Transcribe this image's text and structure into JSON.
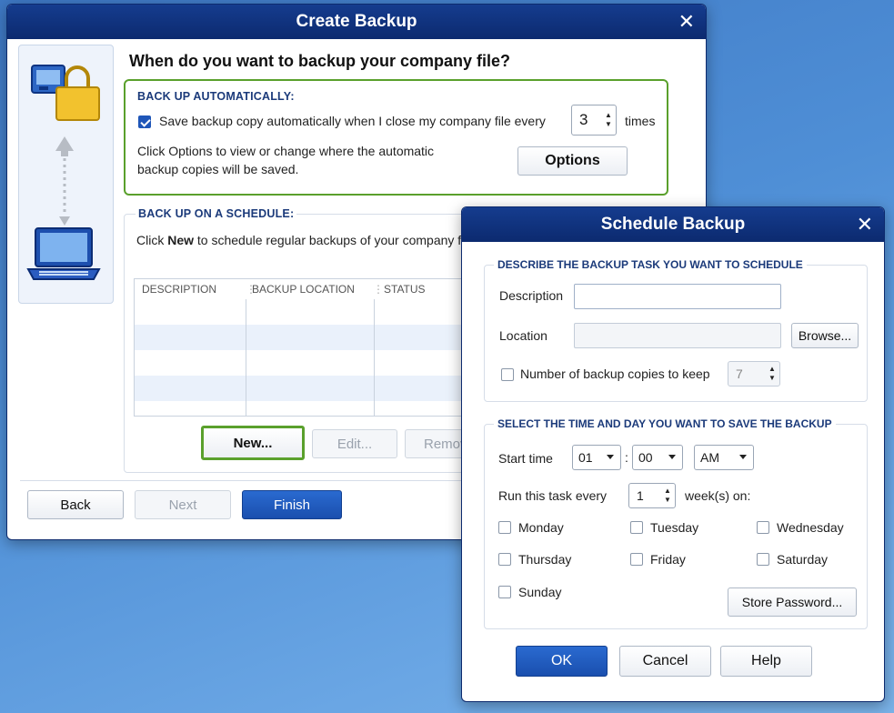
{
  "create_backup": {
    "title": "Create Backup",
    "heading": "When do you want to backup your company file?",
    "auto": {
      "label": "BACK UP AUTOMATICALLY:",
      "checkbox_text": "Save backup copy automatically when I close my company file every",
      "copies_value": "3",
      "times_label": "times",
      "options_text_line1": "Click Options to view or change where the automatic",
      "options_text_line2": "backup copies will be saved.",
      "options_button": "Options"
    },
    "schedule": {
      "label": "BACK UP ON A SCHEDULE:",
      "hint_prefix": "Click ",
      "hint_bold": "New",
      "hint_suffix": " to schedule regular backups of your company file.",
      "columns": [
        "DESCRIPTION",
        "BACKUP LOCATION",
        "STATUS"
      ],
      "new_button": "New...",
      "edit_button": "Edit...",
      "remove_button": "Remove"
    },
    "footer": {
      "back": "Back",
      "next": "Next",
      "finish": "Finish"
    }
  },
  "schedule_backup": {
    "title": "Schedule Backup",
    "task_group_label": "DESCRIBE THE BACKUP TASK YOU WANT TO SCHEDULE",
    "description_label": "Description",
    "description_value": "",
    "location_label": "Location",
    "location_value": "",
    "browse_button": "Browse...",
    "copies_label": "Number of backup copies to keep",
    "copies_value": "7",
    "time_group_label": "SELECT THE TIME AND DAY YOU WANT TO SAVE THE BACKUP",
    "start_time_label": "Start time",
    "hour": "01",
    "colon": ":",
    "minute": "00",
    "ampm": "AM",
    "run_every_label": "Run this task every",
    "run_every_value": "1",
    "weeks_label": "week(s) on:",
    "days": [
      "Monday",
      "Tuesday",
      "Wednesday",
      "Thursday",
      "Friday",
      "Saturday",
      "Sunday"
    ],
    "store_password_button": "Store Password...",
    "ok_button": "OK",
    "cancel_button": "Cancel",
    "help_button": "Help"
  },
  "colors": {
    "title_bar": "#0c2a6f",
    "highlight_green": "#5aa02c",
    "primary_button": "#1a4fae",
    "section_label": "#1b3a7a"
  }
}
